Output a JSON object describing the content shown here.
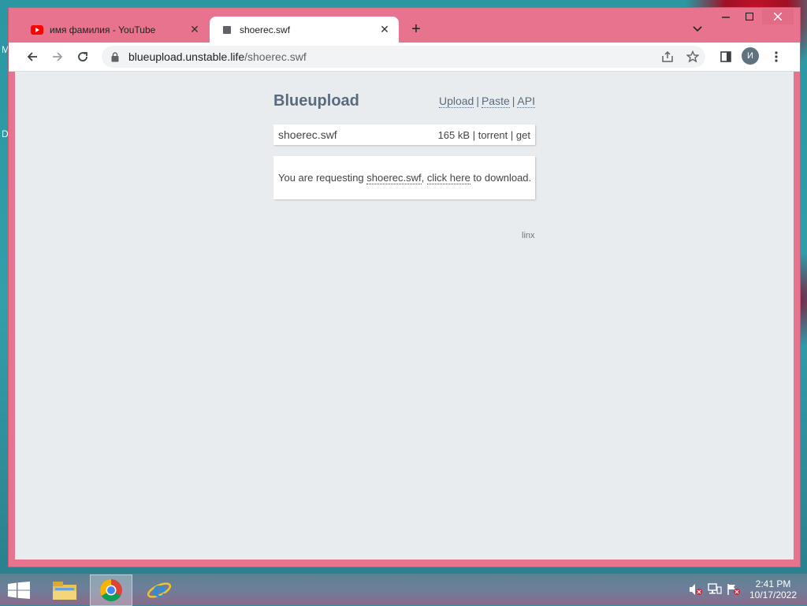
{
  "desktop": {
    "edge_letters": [
      "M",
      "D"
    ]
  },
  "browser": {
    "tabs": [
      {
        "title": "имя фамилия - YouTube",
        "icon": "youtube-icon",
        "active": false
      },
      {
        "title": "shoerec.swf",
        "icon": "page-icon",
        "active": true
      }
    ],
    "new_tab_label": "+",
    "address": {
      "host": "blueupload.unstable.life",
      "path": "/shoerec.swf"
    },
    "profile_initial": "И"
  },
  "page": {
    "site_title": "Blueupload",
    "nav": {
      "upload": "Upload",
      "paste": "Paste",
      "api": "API",
      "separator": "|"
    },
    "file": {
      "name": "shoerec.swf",
      "size": "165 kB",
      "torrent": "torrent",
      "get": "get",
      "separator": "|"
    },
    "request": {
      "prefix": "You are requesting ",
      "file_link": "shoerec.swf",
      "comma": ", ",
      "click_link": "click here",
      "suffix": " to download."
    },
    "footer": "linx"
  },
  "taskbar": {
    "time": "2:41 PM",
    "date": "10/17/2022",
    "apps": [
      "file-explorer-icon",
      "chrome-icon",
      "internet-explorer-icon"
    ]
  },
  "colors": {
    "window_frame": "#e8738f",
    "page_bg": "#e9ecef",
    "title_color": "#5a6b7d"
  }
}
